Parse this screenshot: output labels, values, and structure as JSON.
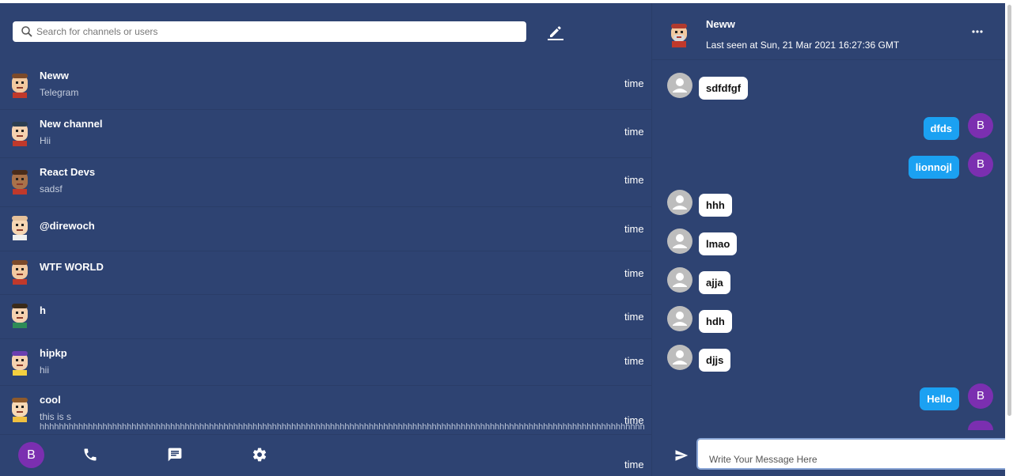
{
  "search": {
    "placeholder": "Search for channels or users"
  },
  "chats": [
    {
      "name": "Neww",
      "preview": "Telegram",
      "time": "time",
      "avatar": "bald-beard-avatar"
    },
    {
      "name": "New channel",
      "preview": "Hii",
      "time": "time",
      "avatar": "glasses-avatar"
    },
    {
      "name": "React Devs",
      "preview": "sadsf",
      "time": "time",
      "avatar": "dark-skin-avatar"
    },
    {
      "name": "@direwoch",
      "preview": "",
      "time": "time",
      "avatar": "bald-avatar"
    },
    {
      "name": "WTF WORLD",
      "preview": "",
      "time": "time",
      "avatar": "bald-beard-avatar"
    },
    {
      "name": "h",
      "preview": "",
      "time": "time",
      "avatar": "curly-glasses-avatar"
    },
    {
      "name": "hipkp",
      "preview": "hii",
      "time": "time",
      "avatar": "sunglasses-avatar"
    },
    {
      "name": "cool",
      "preview": "this is s",
      "time": "time",
      "avatar": "light-avatar"
    }
  ],
  "overflow_text": "hhhhhhhhhhhhhhhhhhhhhhhhhhhhhhhhhhhhhhhhhhhhhhhhhhhhhhhhhhhhhhhhhhhhhhhhhhhhhhhhhhhhhhhhhhhhhhhhhhhhhhhhhhhhhhhhhhhhhhhhhhhhh",
  "bottom_time": "time",
  "nav": {
    "user_initial": "B"
  },
  "chat": {
    "name": "Neww",
    "last_seen": "Last seen at Sun, 21 Mar 2021 16:27:36 GMT",
    "messages": [
      {
        "text": "sdfdfgf",
        "outgoing": false
      },
      {
        "text": "dfds",
        "outgoing": true
      },
      {
        "text": "lionnojl",
        "outgoing": true
      },
      {
        "text": "hhh",
        "outgoing": false
      },
      {
        "text": "lmao",
        "outgoing": false
      },
      {
        "text": "ajja",
        "outgoing": false
      },
      {
        "text": "hdh",
        "outgoing": false
      },
      {
        "text": "djjs",
        "outgoing": false
      },
      {
        "text": "Hello",
        "outgoing": true
      }
    ],
    "sender_initial": "B",
    "input_placeholder": "Write Your Message Here"
  },
  "colors": {
    "background": "#2e4372",
    "outgoing_bubble": "#1ba1f2",
    "avatar_purple": "#7b2fb0"
  }
}
